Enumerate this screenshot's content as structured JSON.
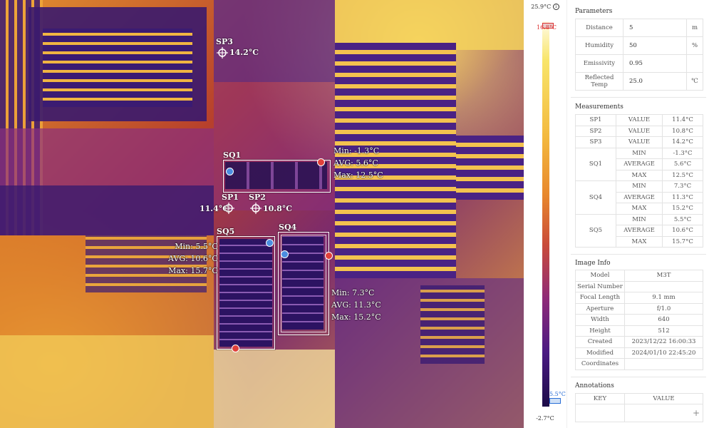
{
  "thermal": {
    "spots": [
      {
        "id": "SP3",
        "label": "SP3",
        "temp": "14.2°C"
      },
      {
        "id": "SP1",
        "label": "SP1",
        "temp": "11.4°C"
      },
      {
        "id": "SP2",
        "label": "SP2",
        "temp": "10.8°C"
      }
    ],
    "boxes": {
      "sq1": {
        "label": "SQ1",
        "min": "Min: -1.3°C",
        "avg": "AVG: 5.6°C",
        "max": "Max: 12.5°C"
      },
      "sq5": {
        "label": "SQ5",
        "min": "Min: 5.5°C",
        "avg": "AVG: 10.6°C",
        "max": "Max: 15.7°C"
      },
      "sq4": {
        "label": "SQ4",
        "min": "Min: 7.3°C",
        "avg": "AVG: 11.3°C",
        "max": "Max: 15.2°C"
      }
    }
  },
  "scale": {
    "max": "25.9°C",
    "min": "-2.7°C",
    "hi_marker": "16.8°C",
    "lo_marker": "5.5°C",
    "info": "i"
  },
  "panel": {
    "parameters": {
      "title": "Parameters",
      "rows": [
        {
          "label": "Distance",
          "value": "5",
          "unit": "m"
        },
        {
          "label": "Humidity",
          "value": "50",
          "unit": "%"
        },
        {
          "label": "Emissivity",
          "value": "0.95",
          "unit": ""
        },
        {
          "label": "Reflected Temp",
          "value": "25.0",
          "unit": "℃"
        }
      ]
    },
    "measurements": {
      "title": "Measurements",
      "sp1": {
        "name": "SP1",
        "k": "VALUE",
        "v": "11.4°C"
      },
      "sp2": {
        "name": "SP2",
        "k": "VALUE",
        "v": "10.8°C"
      },
      "sp3": {
        "name": "SP3",
        "k": "VALUE",
        "v": "14.2°C"
      },
      "sq1": {
        "name": "SQ1",
        "min_k": "MIN",
        "min": "-1.3°C",
        "avg_k": "AVERAGE",
        "avg": "5.6°C",
        "max_k": "MAX",
        "max": "12.5°C"
      },
      "sq4": {
        "name": "SQ4",
        "min_k": "MIN",
        "min": "7.3°C",
        "avg_k": "AVERAGE",
        "avg": "11.3°C",
        "max_k": "MAX",
        "max": "15.2°C"
      },
      "sq5": {
        "name": "SQ5",
        "min_k": "MIN",
        "min": "5.5°C",
        "avg_k": "AVERAGE",
        "avg": "10.6°C",
        "max_k": "MAX",
        "max": "15.7°C"
      }
    },
    "image_info": {
      "title": "Image Info",
      "rows": [
        {
          "label": "Model",
          "value": "M3T"
        },
        {
          "label": "Serial Number",
          "value": ""
        },
        {
          "label": "Focal Length",
          "value": "9.1 mm"
        },
        {
          "label": "Aperture",
          "value": "f/1.0"
        },
        {
          "label": "Width",
          "value": "640"
        },
        {
          "label": "Height",
          "value": "512"
        },
        {
          "label": "Created",
          "value": "2023/12/22 16:00:33"
        },
        {
          "label": "Modified",
          "value": "2024/01/10 22:45:20"
        },
        {
          "label": "Coordinates",
          "value": ""
        }
      ]
    },
    "annotations": {
      "title": "Annotations",
      "key_header": "KEY",
      "value_header": "VALUE",
      "add": "+"
    }
  }
}
